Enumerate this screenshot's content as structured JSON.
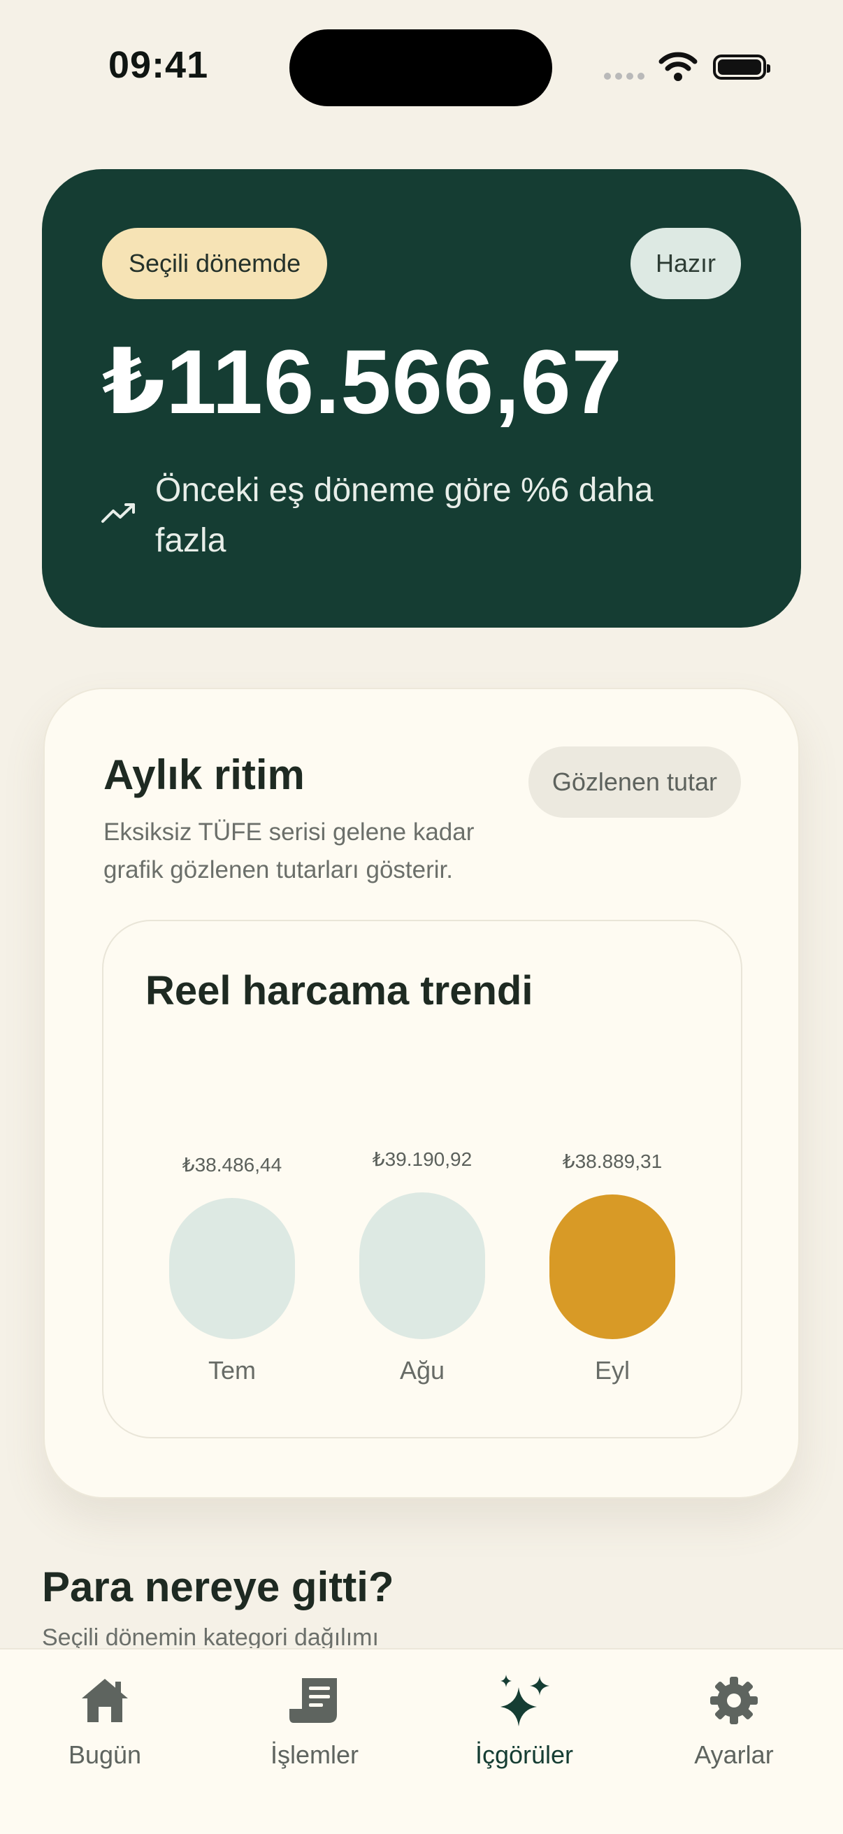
{
  "status_bar": {
    "time": "09:41"
  },
  "hero": {
    "period_label": "Seçili dönemde",
    "status_label": "Hazır",
    "amount": "₺116.566,67",
    "delta_text": "Önceki eş döneme göre %6 daha fazla"
  },
  "rhythm": {
    "title": "Aylık ritim",
    "subtitle": "Eksiksiz TÜFE serisi gelene kadar grafik gözlenen tutarları gösterir.",
    "mode_label": "Gözlenen tutar",
    "chart_title": "Reel harcama trendi"
  },
  "chart_data": {
    "type": "bar",
    "title": "Reel harcama trendi",
    "categories": [
      "Tem",
      "Ağu",
      "Eyl"
    ],
    "values": [
      38486.44,
      39190.92,
      38889.31
    ],
    "value_labels": [
      "₺38.486,44",
      "₺39.190,92",
      "₺38.889,31"
    ],
    "highlighted_index": 2,
    "colors": {
      "default": "#DDE9E3",
      "highlight": "#D89A26"
    }
  },
  "section": {
    "title": "Para nereye gitti?",
    "subtitle": "Seçili dönemin kategori dağılımı"
  },
  "tabbar": {
    "items": [
      {
        "label": "Bugün",
        "icon": "home-icon"
      },
      {
        "label": "İşlemler",
        "icon": "receipt-icon"
      },
      {
        "label": "İçgörüler",
        "icon": "sparkles-icon"
      },
      {
        "label": "Ayarlar",
        "icon": "gear-icon"
      }
    ],
    "active_index": 2
  },
  "colors": {
    "background": "#F5F1E7",
    "hero": "#153D33",
    "card": "#FEFBF2",
    "accent": "#D89A26",
    "pill_yellow": "#F6E3B5",
    "pill_mint": "#DDE9E3"
  }
}
